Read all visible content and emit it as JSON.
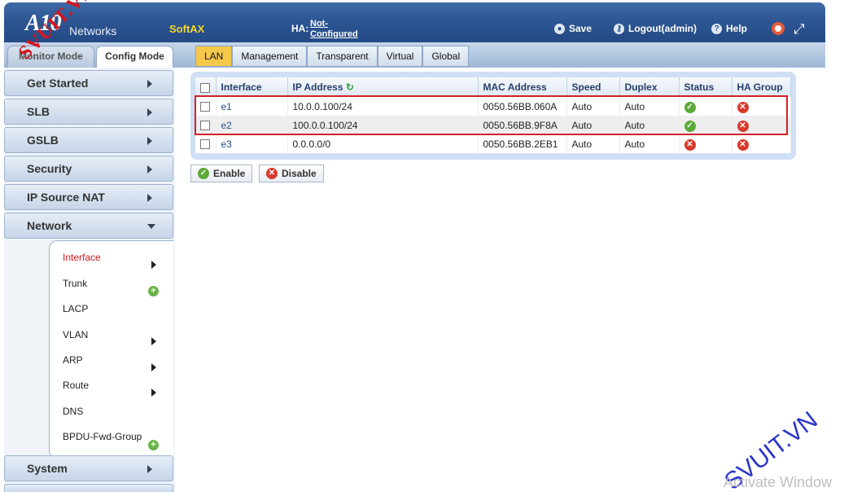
{
  "header": {
    "logo_main": "A10",
    "logo_sub": "Networks",
    "product": "SoftAX",
    "ha_label": "HA:",
    "ha_value_line1": "Not-",
    "ha_value_line2": "Configured",
    "save_label": "Save",
    "logout_label": "Logout(admin)",
    "help_label": "Help"
  },
  "modes": {
    "monitor": "Monitor Mode",
    "config": "Config Mode"
  },
  "tabs": [
    {
      "label": "LAN"
    },
    {
      "label": "Management"
    },
    {
      "label": "Transparent"
    },
    {
      "label": "Virtual"
    },
    {
      "label": "Global"
    }
  ],
  "sidebar": {
    "items": [
      {
        "label": "Get Started"
      },
      {
        "label": "SLB"
      },
      {
        "label": "GSLB"
      },
      {
        "label": "Security"
      },
      {
        "label": "IP Source NAT"
      },
      {
        "label": "Network"
      },
      {
        "label": "System"
      }
    ],
    "network_sub": [
      {
        "label": "Interface"
      },
      {
        "label": "Trunk"
      },
      {
        "label": "LACP"
      },
      {
        "label": "VLAN"
      },
      {
        "label": "ARP"
      },
      {
        "label": "Route"
      },
      {
        "label": "DNS"
      },
      {
        "label": "BPDU-Fwd-Group"
      }
    ]
  },
  "table": {
    "headers": [
      "Interface",
      "IP Address",
      "MAC Address",
      "Speed",
      "Duplex",
      "Status",
      "HA Group"
    ],
    "rows": [
      {
        "interface": "e1",
        "ip": "10.0.0.100/24",
        "mac": "0050.56BB.060A",
        "speed": "Auto",
        "duplex": "Auto",
        "status": "enabled",
        "ha": "disabled"
      },
      {
        "interface": "e2",
        "ip": "100.0.0.100/24",
        "mac": "0050.56BB.9F8A",
        "speed": "Auto",
        "duplex": "Auto",
        "status": "enabled",
        "ha": "disabled"
      },
      {
        "interface": "e3",
        "ip": "0.0.0.0/0",
        "mac": "0050.56BB.2EB1",
        "speed": "Auto",
        "duplex": "Auto",
        "status": "disabled",
        "ha": "disabled"
      }
    ]
  },
  "actions": {
    "enable": "Enable",
    "disable": "Disable"
  },
  "overlay": {
    "watermark_left": "SVUIT.VN",
    "watermark_right": "SVUIT.VN",
    "activate": "Activate Window"
  },
  "colors": {
    "accent": "#2d5693",
    "active_tab": "#f5c84a",
    "highlight": "#d22128"
  }
}
